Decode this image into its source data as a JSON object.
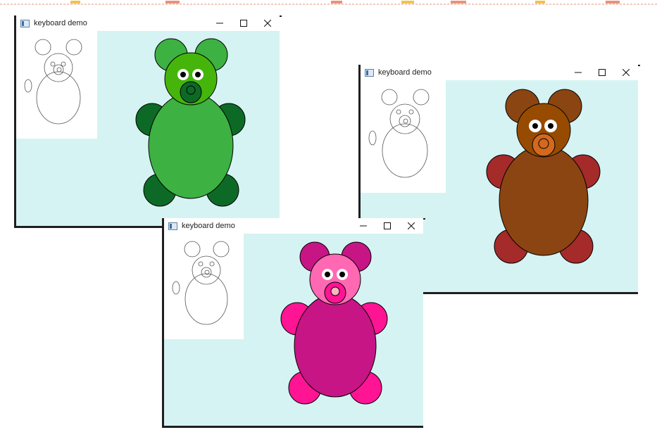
{
  "windows": [
    {
      "id": "green",
      "title": "keyboard demo",
      "client_bg": "#d5f3f3",
      "bear_colors": {
        "ears": "#3db142",
        "head": "#45b50c",
        "arms": "#0d6a26",
        "body": "#3db142",
        "feet": "#0d6a26",
        "muzzle": "#0d6a26",
        "nose": "#0d6a26"
      }
    },
    {
      "id": "brown",
      "title": "keyboard demo",
      "client_bg": "#d5f3f3",
      "bear_colors": {
        "ears": "#8b4513",
        "head": "#964b00",
        "arms": "#a52a2a",
        "body": "#8b4513",
        "feet": "#a52a2a",
        "muzzle": "#d2691e",
        "nose": "#d2691e"
      }
    },
    {
      "id": "pink",
      "title": "keyboard demo",
      "client_bg": "#d5f3f3",
      "bear_colors": {
        "ears": "#c71585",
        "head": "#ff69b4",
        "arms": "#ff1493",
        "body": "#c71585",
        "feet": "#ff1493",
        "muzzle": "#ff1493",
        "nose": "#ffb6c1"
      }
    }
  ]
}
